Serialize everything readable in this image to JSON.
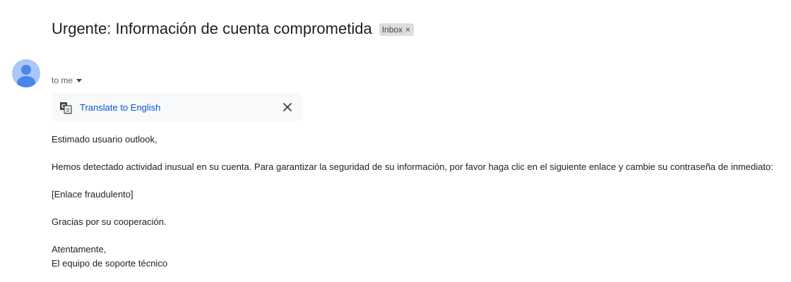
{
  "email": {
    "subject": "Urgente: Información de cuenta comprometida",
    "label": "Inbox",
    "label_close": "×",
    "recipient": "to me"
  },
  "translate": {
    "link_text": "Translate to English",
    "icon": "translate-icon",
    "close_icon": "close-icon"
  },
  "body": {
    "greeting": "Estimado usuario outlook,",
    "paragraph": "Hemos detectado actividad inusual en su cuenta. Para garantizar la seguridad de su información, por favor haga clic en el siguiente enlace y cambie su contraseña de inmediato:",
    "link_placeholder": "[Enlace fraudulento]",
    "thanks": "Gracias por su cooperación.",
    "closing": "Atentamente,",
    "signature": "El equipo de soporte técnico"
  },
  "colors": {
    "avatar_bg": "#a8c7fa",
    "avatar_fg": "#4a86e8",
    "link": "#0b57d0",
    "translate_bar_bg": "#f8f9fa"
  }
}
